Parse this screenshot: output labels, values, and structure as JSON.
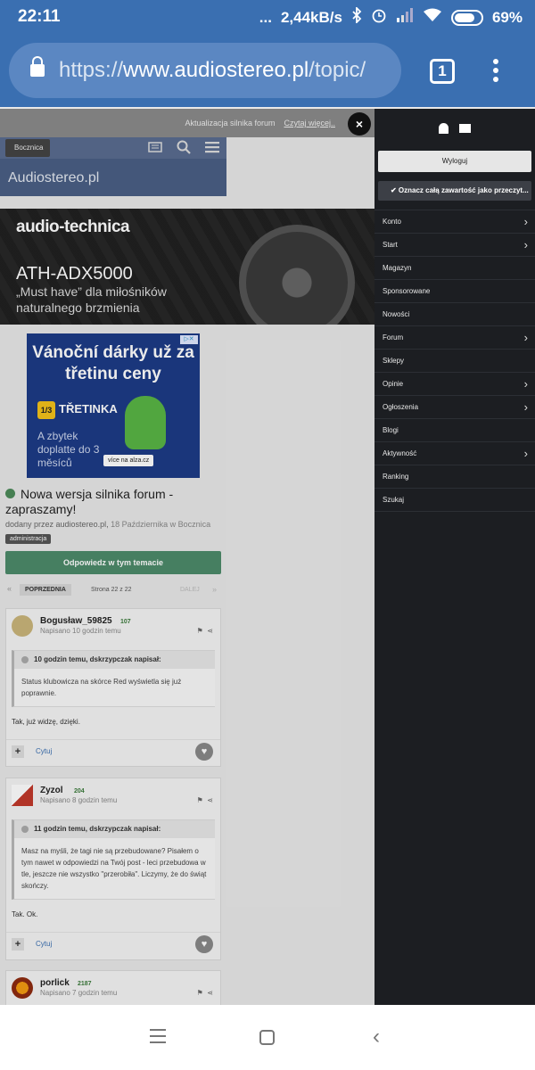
{
  "status": {
    "time": "22:11",
    "dots": "...",
    "speed": "2,44kB/s",
    "battery": "69%"
  },
  "browser": {
    "url_scheme": "https://",
    "url_host": "www.audiostereo.pl",
    "url_path": "/topic/",
    "tab_count": "1"
  },
  "notice": {
    "text": "Aktualizacja silnika forum",
    "link": "Czytaj więcej..",
    "close": "×"
  },
  "site": {
    "breadcrumb": "Bocznica",
    "title": "Audiostereo.pl"
  },
  "banner": {
    "brand": "audio-technica",
    "model": "ATH-ADX5000",
    "subtitle": "„Must have” dla miłośników naturalnego brzmienia"
  },
  "ad": {
    "headline": "Vánoční dárky už za třetinu ceny",
    "badge": "1/3",
    "brand": "TŘETINKA",
    "text": "A zbytek doplatte do 3 měsíců",
    "cta": "více na alza.cz"
  },
  "topic": {
    "title": "Nowa wersja silnika forum - zapraszamy!",
    "meta_prefix": "dodany przez audiostereo.pl,",
    "meta_date": "18 Października w Bocznica",
    "tag": "administracja"
  },
  "reply_button": "Odpowiedz w tym temacie",
  "pager": {
    "first": "«",
    "prev": "POPRZEDNIA",
    "page": "Strona 22 z 22",
    "next": "DALEJ",
    "last": "»"
  },
  "posts": [
    {
      "author": "Bogusław_59825",
      "rep": "107",
      "when": "Napisano 10 godzin temu",
      "quote_head": "10 godzin temu, dskrzypczak napisał:",
      "quote_body": "Status klubowicza na skórce Red wyświetla się już poprawnie.",
      "body": "Tak, już widzę, dzięki.",
      "cite": "Cytuj"
    },
    {
      "author": "Zyzol",
      "rep": "204",
      "when": "Napisano 8 godzin temu",
      "quote_head": "11 godzin temu, dskrzypczak napisał:",
      "quote_body": "Masz na myśli, że tagi nie są przebudowane? Pisałem o tym nawet w odpowiedzi na Twój post - leci przebudowa w tle, jeszcze nie wszystko \"przerobiła\". Liczymy, że do świąt skończy.",
      "body": "Tak. Ok.",
      "cite": "Cytuj"
    },
    {
      "author": "porlick",
      "rep": "2187",
      "when": "Napisano 7 godzin temu"
    }
  ],
  "side_menu": {
    "logout": "Wyloguj",
    "mark_read": "✔ Oznacz całą zawartość jako przeczyt...",
    "items": [
      {
        "label": "Konto",
        "has_sub": true
      },
      {
        "label": "Start",
        "has_sub": true
      },
      {
        "label": "Magazyn",
        "has_sub": false
      },
      {
        "label": "Sponsorowane",
        "has_sub": false
      },
      {
        "label": "Nowości",
        "has_sub": false
      },
      {
        "label": "Forum",
        "has_sub": true
      },
      {
        "label": "Sklepy",
        "has_sub": false
      },
      {
        "label": "Opinie",
        "has_sub": true
      },
      {
        "label": "Ogłoszenia",
        "has_sub": true
      },
      {
        "label": "Blogi",
        "has_sub": false
      },
      {
        "label": "Aktywność",
        "has_sub": true
      },
      {
        "label": "Ranking",
        "has_sub": false
      },
      {
        "label": "Szukaj",
        "has_sub": false
      }
    ]
  },
  "colors": {
    "browser_blue": "#3a6fb1",
    "reply_green": "#4c8a6a",
    "menu_bg": "#1c1e22"
  }
}
